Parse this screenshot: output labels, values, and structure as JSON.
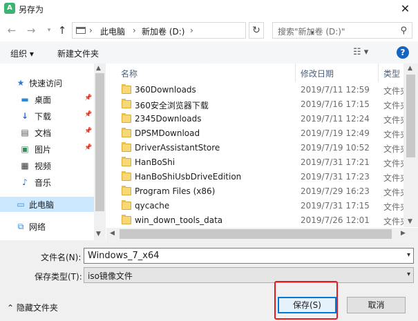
{
  "window": {
    "title": "另存为",
    "app_icon": "app-logo-icon"
  },
  "nav": {
    "breadcrumbs": [
      "此电脑",
      "新加卷 (D:)"
    ],
    "search_placeholder": "搜索\"新加卷 (D:)\""
  },
  "toolbar": {
    "organize": "组织 ▾",
    "new_folder": "新建文件夹"
  },
  "sidebar": {
    "items": [
      {
        "label": "快速访问",
        "icon": "star-icon",
        "pinned": false
      },
      {
        "label": "桌面",
        "icon": "desktop-icon",
        "pinned": true
      },
      {
        "label": "下载",
        "icon": "download-icon",
        "pinned": true
      },
      {
        "label": "文档",
        "icon": "document-icon",
        "pinned": true
      },
      {
        "label": "图片",
        "icon": "picture-icon",
        "pinned": true
      },
      {
        "label": "视频",
        "icon": "video-icon",
        "pinned": false
      },
      {
        "label": "音乐",
        "icon": "music-icon",
        "pinned": false
      },
      {
        "label": "此电脑",
        "icon": "computer-icon",
        "pinned": false
      },
      {
        "label": "网络",
        "icon": "network-icon",
        "pinned": false
      }
    ]
  },
  "files": {
    "columns": {
      "name": "名称",
      "date": "修改日期",
      "type": "类型"
    },
    "rows": [
      {
        "name": "360Downloads",
        "date": "2019/7/11 12:59",
        "type": "文件夹"
      },
      {
        "name": "360安全浏览器下载",
        "date": "2019/7/16 17:15",
        "type": "文件夹"
      },
      {
        "name": "2345Downloads",
        "date": "2019/7/11 12:24",
        "type": "文件夹"
      },
      {
        "name": "DPSMDownload",
        "date": "2019/7/19 12:49",
        "type": "文件夹"
      },
      {
        "name": "DriverAssistantStore",
        "date": "2019/7/19 10:52",
        "type": "文件夹"
      },
      {
        "name": "HanBoShi",
        "date": "2019/7/31 17:21",
        "type": "文件夹"
      },
      {
        "name": "HanBoShiUsbDriveEdition",
        "date": "2019/7/31 17:23",
        "type": "文件夹"
      },
      {
        "name": "Program Files (x86)",
        "date": "2019/7/29 16:23",
        "type": "文件夹"
      },
      {
        "name": "qycache",
        "date": "2019/7/31 17:15",
        "type": "文件夹"
      },
      {
        "name": "win_down_tools_data",
        "date": "2019/7/26 12:01",
        "type": "文件夹"
      }
    ]
  },
  "form": {
    "filename_label": "文件名(N):",
    "filename_value": "Windows_7_x64",
    "filetype_label": "保存类型(T):",
    "filetype_value": "iso镜像文件"
  },
  "footer": {
    "hide_folders": "隐藏文件夹",
    "save": "保存(S)",
    "cancel": "取消"
  },
  "colors": {
    "accent": "#0078d7",
    "highlight": "#e8181e",
    "selected": "#cce8ff"
  }
}
